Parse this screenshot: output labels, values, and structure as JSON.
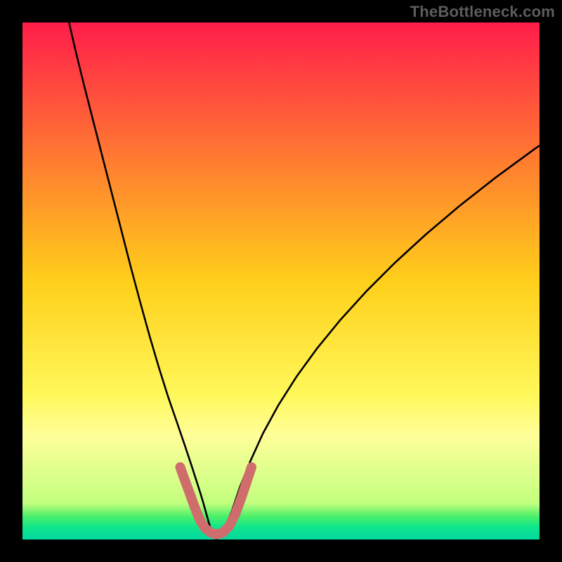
{
  "watermark": {
    "text": "TheBottleneck.com"
  },
  "chart_data": {
    "type": "line",
    "title": "",
    "xlabel": "",
    "ylabel": "",
    "xlim": [
      0,
      100
    ],
    "ylim": [
      0,
      100
    ],
    "grid": false,
    "legend": false,
    "background_gradient": {
      "stops": [
        {
          "offset": 0.0,
          "color": "#ff1d4a"
        },
        {
          "offset": 0.5,
          "color": "#ffcf1a"
        },
        {
          "offset": 0.72,
          "color": "#fff85a"
        },
        {
          "offset": 0.8,
          "color": "#ffff9a"
        },
        {
          "offset": 0.93,
          "color": "#c2ff7e"
        },
        {
          "offset": 0.955,
          "color": "#4cf06a"
        },
        {
          "offset": 0.975,
          "color": "#12e68a"
        },
        {
          "offset": 1.0,
          "color": "#00d8a0"
        }
      ]
    },
    "series": [
      {
        "name": "left-curve",
        "color": "#000000",
        "width": 2.6,
        "points": [
          {
            "x": 9.0,
            "y": 100.0
          },
          {
            "x": 10.4,
            "y": 94.0
          },
          {
            "x": 12.0,
            "y": 87.5
          },
          {
            "x": 13.8,
            "y": 80.5
          },
          {
            "x": 15.6,
            "y": 73.5
          },
          {
            "x": 17.4,
            "y": 66.5
          },
          {
            "x": 19.2,
            "y": 59.5
          },
          {
            "x": 21.0,
            "y": 52.5
          },
          {
            "x": 22.8,
            "y": 45.8
          },
          {
            "x": 24.6,
            "y": 39.3
          },
          {
            "x": 26.4,
            "y": 33.2
          },
          {
            "x": 28.2,
            "y": 27.5
          },
          {
            "x": 30.0,
            "y": 22.3
          },
          {
            "x": 31.4,
            "y": 18.2
          },
          {
            "x": 32.6,
            "y": 14.6
          },
          {
            "x": 33.6,
            "y": 11.5
          },
          {
            "x": 34.4,
            "y": 9.0
          },
          {
            "x": 35.0,
            "y": 7.0
          },
          {
            "x": 35.5,
            "y": 5.2
          },
          {
            "x": 36.0,
            "y": 3.4
          },
          {
            "x": 36.6,
            "y": 1.5
          },
          {
            "x": 37.5,
            "y": 0.0
          }
        ]
      },
      {
        "name": "right-curve",
        "color": "#000000",
        "width": 2.6,
        "points": [
          {
            "x": 37.5,
            "y": 0.0
          },
          {
            "x": 39.0,
            "y": 2.0
          },
          {
            "x": 40.5,
            "y": 5.5
          },
          {
            "x": 42.0,
            "y": 10.0
          },
          {
            "x": 44.0,
            "y": 15.0
          },
          {
            "x": 46.5,
            "y": 20.5
          },
          {
            "x": 49.5,
            "y": 26.0
          },
          {
            "x": 53.0,
            "y": 31.5
          },
          {
            "x": 57.0,
            "y": 37.0
          },
          {
            "x": 61.5,
            "y": 42.5
          },
          {
            "x": 66.5,
            "y": 48.0
          },
          {
            "x": 72.0,
            "y": 53.5
          },
          {
            "x": 78.0,
            "y": 59.0
          },
          {
            "x": 84.5,
            "y": 64.5
          },
          {
            "x": 91.5,
            "y": 70.0
          },
          {
            "x": 99.0,
            "y": 75.5
          },
          {
            "x": 100.0,
            "y": 76.2
          }
        ]
      },
      {
        "name": "valley-marker",
        "color": "#cf6d6d",
        "width": 14,
        "linecap": "round",
        "points": [
          {
            "x": 30.5,
            "y": 14.0
          },
          {
            "x": 31.5,
            "y": 11.2
          },
          {
            "x": 32.5,
            "y": 8.5
          },
          {
            "x": 33.4,
            "y": 6.0
          },
          {
            "x": 34.3,
            "y": 3.8
          },
          {
            "x": 35.3,
            "y": 2.2
          },
          {
            "x": 36.5,
            "y": 1.3
          },
          {
            "x": 37.5,
            "y": 1.0
          },
          {
            "x": 38.7,
            "y": 1.3
          },
          {
            "x": 40.0,
            "y": 2.6
          },
          {
            "x": 41.2,
            "y": 5.0
          },
          {
            "x": 42.3,
            "y": 8.0
          },
          {
            "x": 43.3,
            "y": 11.0
          },
          {
            "x": 44.3,
            "y": 14.0
          }
        ]
      }
    ]
  }
}
